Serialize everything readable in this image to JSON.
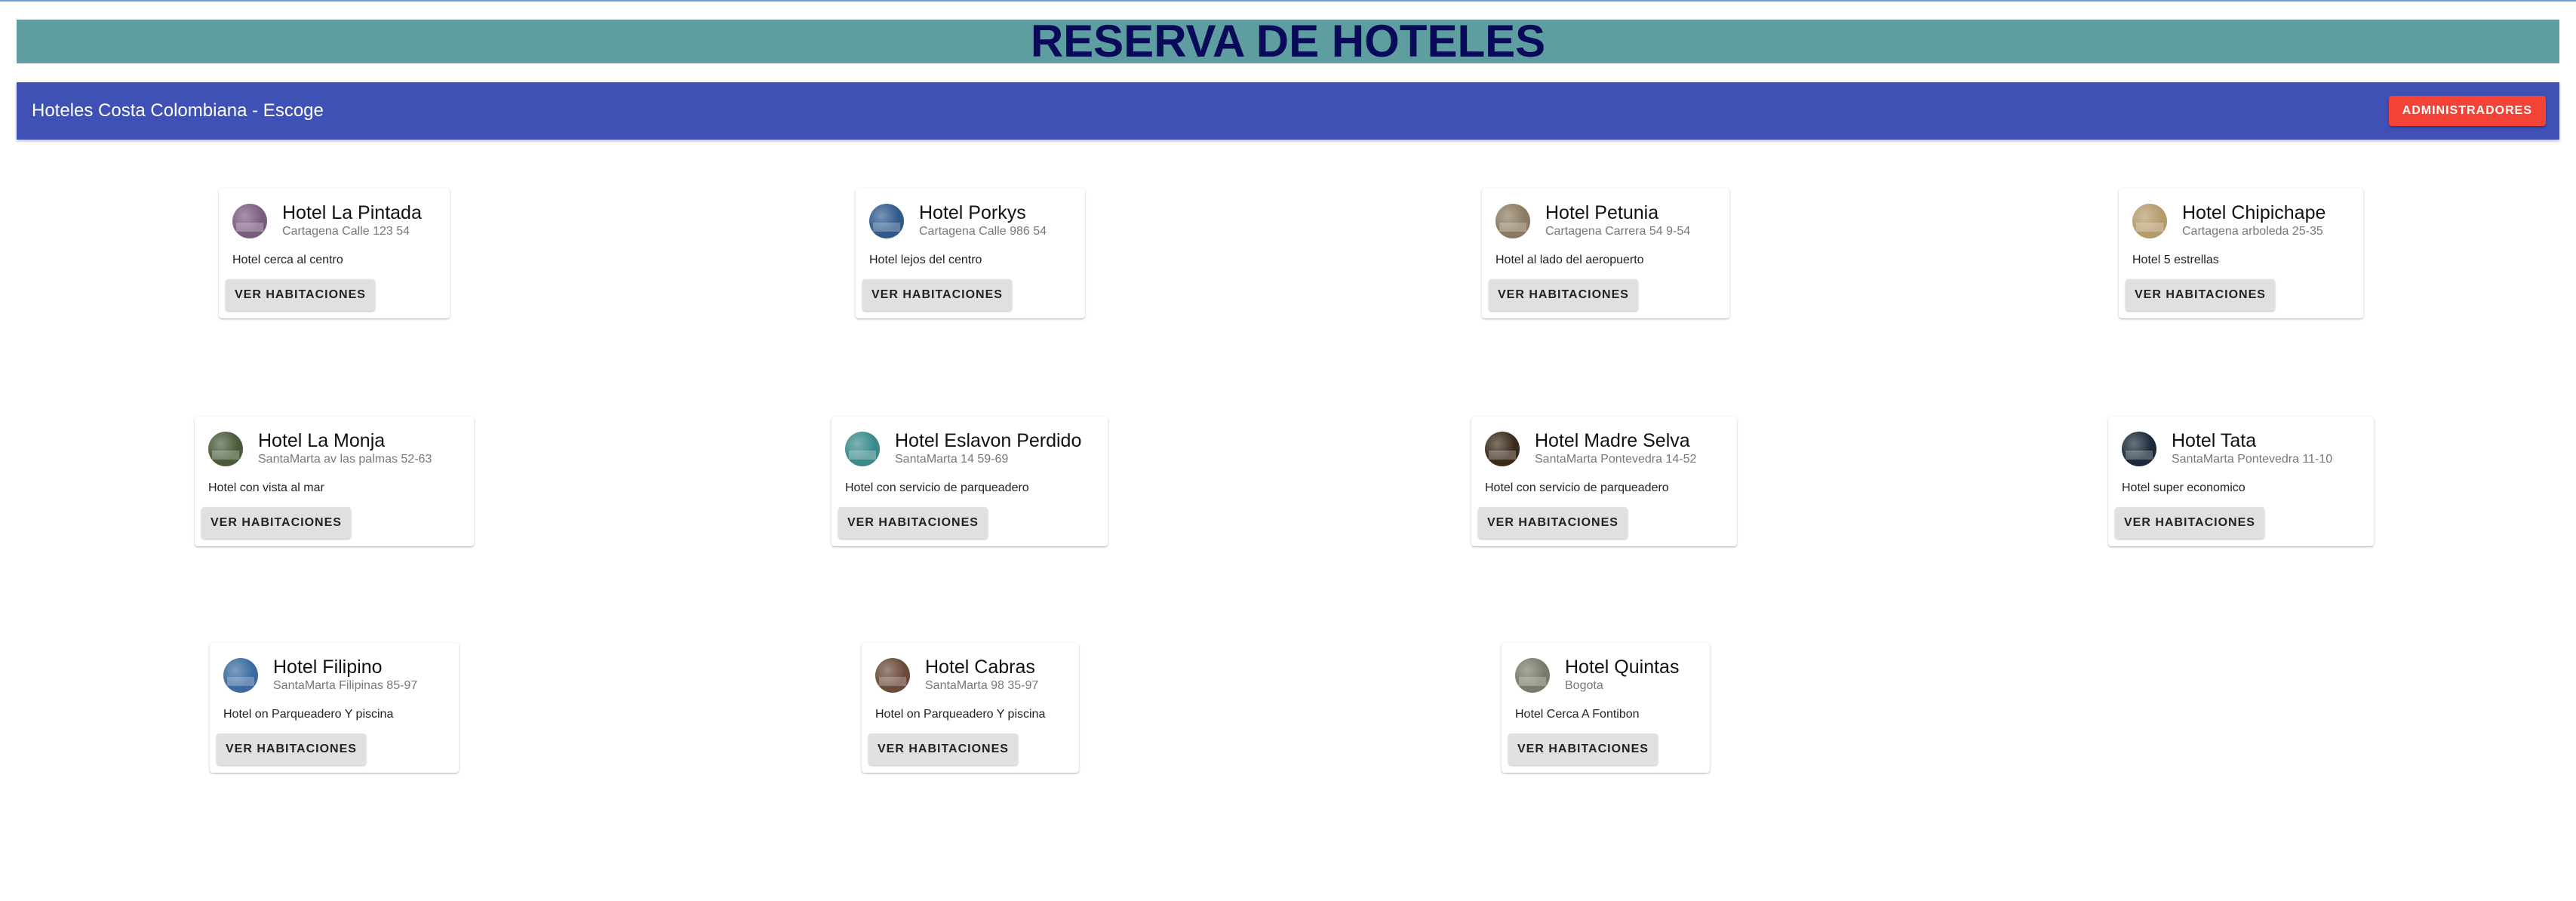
{
  "page_title": "RESERVA DE HOTELES",
  "appbar": {
    "title": "Hoteles Costa Colombiana - Escoge",
    "admin_label": "ADMINISTRADORES"
  },
  "card_action_label": "VER HABITACIONES",
  "hotels": [
    {
      "name": "Hotel La Pintada",
      "address": "Cartagena Calle 123 54",
      "description": "Hotel cerca al centro",
      "avatar_color": "#7a5c7e"
    },
    {
      "name": "Hotel Porkys",
      "address": "Cartagena Calle 986 54",
      "description": "Hotel lejos del centro",
      "avatar_color": "#2f5a8a"
    },
    {
      "name": "Hotel Petunia",
      "address": "Cartagena Carrera 54 9-54",
      "description": "Hotel al lado del aeropuerto",
      "avatar_color": "#8a7a60"
    },
    {
      "name": "Hotel Chipichape",
      "address": "Cartagena arboleda 25-35",
      "description": "Hotel 5 estrellas",
      "avatar_color": "#b59a6a"
    },
    {
      "name": "Hotel La Monja",
      "address": "SantaMarta av las palmas 52-63",
      "description": "Hotel con vista al mar",
      "avatar_color": "#4a5a3a"
    },
    {
      "name": "Hotel Eslavon Perdido",
      "address": "SantaMarta 14 59-69",
      "description": "Hotel con servicio de parqueadero",
      "avatar_color": "#3a8a8a"
    },
    {
      "name": "Hotel Madre Selva",
      "address": "SantaMarta Pontevedra 14-52",
      "description": "Hotel con servicio de parqueadero",
      "avatar_color": "#3a2a1a"
    },
    {
      "name": "Hotel Tata",
      "address": "SantaMarta Pontevedra 11-10",
      "description": "Hotel super economico",
      "avatar_color": "#1a2a3a"
    },
    {
      "name": "Hotel Filipino",
      "address": "SantaMarta Filipinas 85-97",
      "description": "Hotel on Parqueadero Y piscina",
      "avatar_color": "#3a6aa0"
    },
    {
      "name": "Hotel Cabras",
      "address": "SantaMarta 98 35-97",
      "description": "Hotel on Parqueadero Y piscina",
      "avatar_color": "#6a4a3a"
    },
    {
      "name": "Hotel Quintas",
      "address": "Bogota",
      "description": "Hotel Cerca A Fontibon",
      "avatar_color": "#7a7a6a"
    }
  ]
}
